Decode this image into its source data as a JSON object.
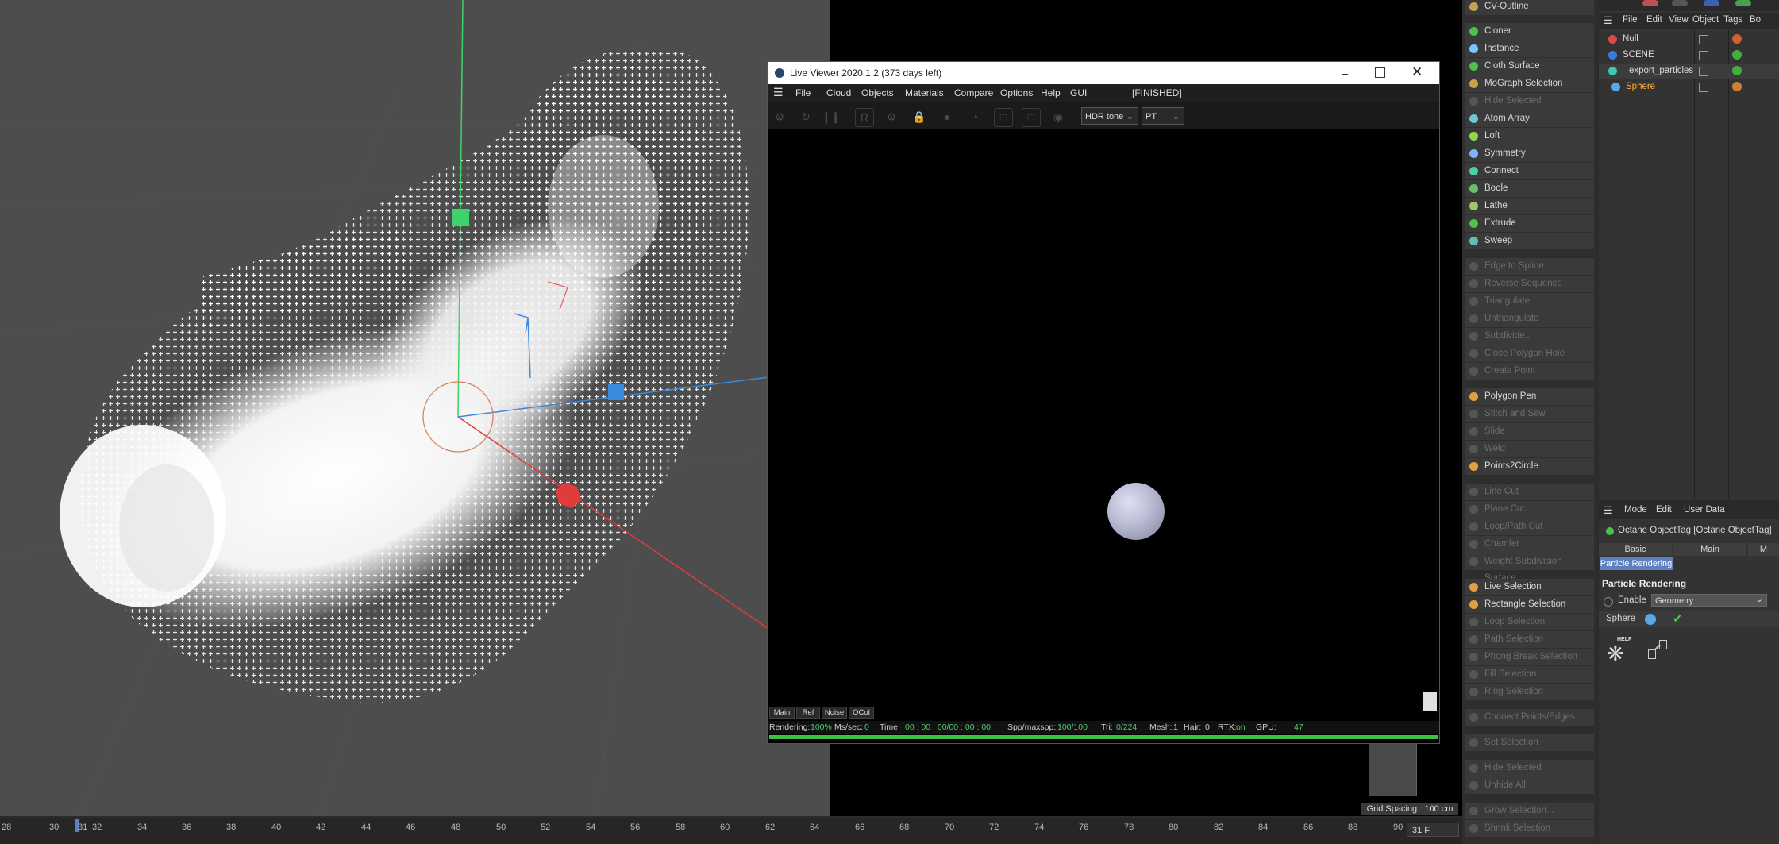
{
  "viewport": {
    "grid_spacing": "Grid Spacing : 100 cm"
  },
  "live_viewer": {
    "title": "Live Viewer 2020.1.2 (373 days left)",
    "menu": [
      "File",
      "Cloud",
      "Objects",
      "Materials",
      "Compare",
      "Options",
      "Help",
      "GUI"
    ],
    "state": "[FINISHED]",
    "tonemap_select": "HDR tone",
    "kernel_select": "PT",
    "tabs": [
      "Main",
      "Ref",
      "Noise",
      "OCol"
    ],
    "status": {
      "rendering_label": "Rendering:",
      "rendering_value": "100%",
      "ms_label": "Ms/sec:",
      "ms_value": "0",
      "time_label": "Time:",
      "time_value": "00 : 00 : 00/00 : 00 : 00",
      "spp_label": "Spp/maxspp:",
      "spp_value": "100/100",
      "tri_label": "Tri:",
      "tri_value": "0/224",
      "mesh_label": "Mesh:",
      "mesh_value": "1",
      "hair_label": "Hair:",
      "hair_value": "0",
      "rtx_label": "RTX:",
      "rtx_value": "on",
      "gpu_label": "GPU:",
      "gpu_value": "47"
    },
    "progress": 1.0
  },
  "tools": {
    "top": "CV-Outline",
    "group1": [
      "Cloner",
      "Instance",
      "Cloth Surface",
      "MoGraph Selection",
      "Hide Selected",
      "Atom Array",
      "Loft",
      "Symmetry",
      "Connect",
      "Boole",
      "Lathe",
      "Extrude",
      "Sweep"
    ],
    "group1_disabled": [
      false,
      false,
      false,
      false,
      true,
      false,
      false,
      false,
      false,
      false,
      false,
      false,
      false
    ],
    "group2": [
      "Edge to Spline",
      "Reverse Sequence",
      "Triangulate",
      "Untriangulate",
      "Subdivide...",
      "Close Polygon Hole",
      "Create Point"
    ],
    "group3": [
      "Polygon Pen",
      "Stitch and Sew",
      "Slide",
      "Weld",
      "Points2Circle"
    ],
    "group3_disabled": [
      false,
      true,
      true,
      true,
      false
    ],
    "group4": [
      "Line Cut",
      "Plane Cut",
      "Loop/Path Cut",
      "Chamfer",
      "Weight Subdivision Surface"
    ],
    "group5": [
      "Live Selection",
      "Rectangle Selection",
      "Loop Selection",
      "Path Selection",
      "Phong Break Selection",
      "Fill Selection",
      "Ring Selection"
    ],
    "group5_disabled": [
      false,
      false,
      true,
      true,
      true,
      true,
      true
    ],
    "group6": [
      "Connect Points/Edges"
    ],
    "group7": [
      "Set Selection"
    ],
    "group8": [
      "Hide Selected",
      "Unhide All"
    ],
    "group9": [
      "Grow Selection...",
      "Shrink Selection"
    ]
  },
  "object_manager": {
    "menu": [
      "File",
      "Edit",
      "View",
      "Object",
      "Tags",
      "Bo"
    ],
    "objects": [
      {
        "name": "Null",
        "color": "#e04848"
      },
      {
        "name": "SCENE",
        "color": "#3a7be0"
      },
      {
        "name": "export_particles",
        "color": "#3fc8b0"
      },
      {
        "name": "Sphere",
        "color": "#5aa8e8"
      }
    ]
  },
  "attribute_manager": {
    "menu": [
      "Mode",
      "Edit",
      "User Data"
    ],
    "title": "Octane ObjectTag [Octane ObjectTag]",
    "tabs": [
      "Basic",
      "Main",
      "M"
    ],
    "active_tab": "Particle Rendering",
    "section": "Particle Rendering",
    "enable_label": "Enable",
    "enable_value": "Geometry",
    "sphere_label": "Sphere",
    "help_label": "HELP"
  },
  "timeline": {
    "ticks": [
      "28",
      "30",
      "31",
      "32",
      "34",
      "36",
      "38",
      "40",
      "42",
      "44",
      "46",
      "48",
      "50",
      "52",
      "54",
      "56",
      "58",
      "60",
      "62",
      "64",
      "66",
      "68",
      "70",
      "72",
      "74",
      "76",
      "78",
      "80",
      "82",
      "84",
      "86",
      "88",
      "90"
    ],
    "current_frame": "31 F"
  },
  "colors": {
    "accent_green": "#39c43f",
    "axis_x": "#e03c3c",
    "axis_y": "#3ed36a",
    "axis_z": "#3c8ae0",
    "selected_object": "#ffb030"
  }
}
